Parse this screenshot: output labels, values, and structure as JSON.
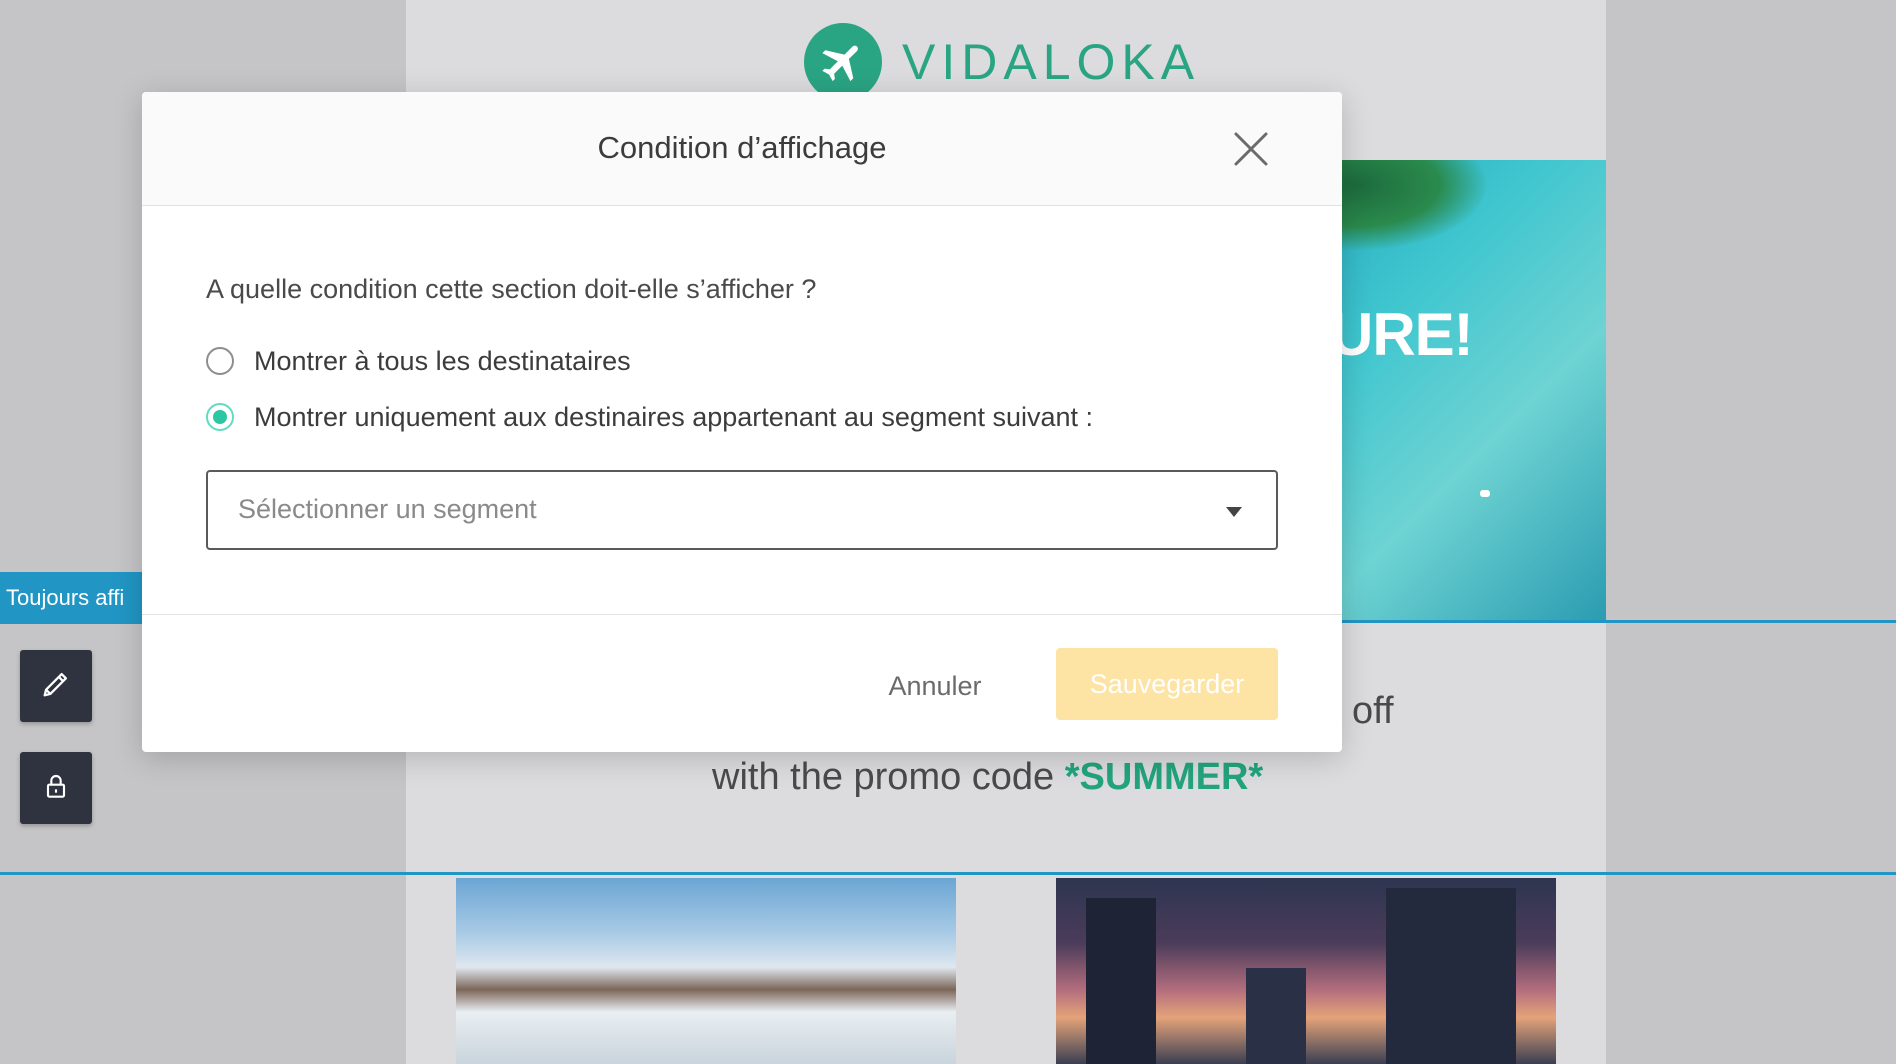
{
  "background": {
    "brand_name": "VIDALOKA",
    "hero_text": "URE!",
    "promo_off_text": "off",
    "promo_prefix": "with the promo code ",
    "promo_code": "*SUMMER*",
    "status_tag": "Toujours affi",
    "accent_color": "#2196c4",
    "brand_color": "#2aa583"
  },
  "toolbar": {
    "edit_icon": "pencil-icon",
    "lock_icon": "lock-icon"
  },
  "modal": {
    "title": "Condition d’affichage",
    "close_icon": "close-icon",
    "question": "A quelle condition cette section doit-elle s’afficher ?",
    "options": [
      {
        "label": "Montrer à tous les destinataires",
        "selected": false
      },
      {
        "label": "Montrer uniquement aux destinaires appartenant au segment suivant :",
        "selected": true
      }
    ],
    "segment_select": {
      "placeholder": "Sélectionner un segment",
      "value": ""
    },
    "cancel_label": "Annuler",
    "save_label": "Sauvegarder",
    "radio_color": "#2ac7a5",
    "save_color": "#fde3a4"
  }
}
